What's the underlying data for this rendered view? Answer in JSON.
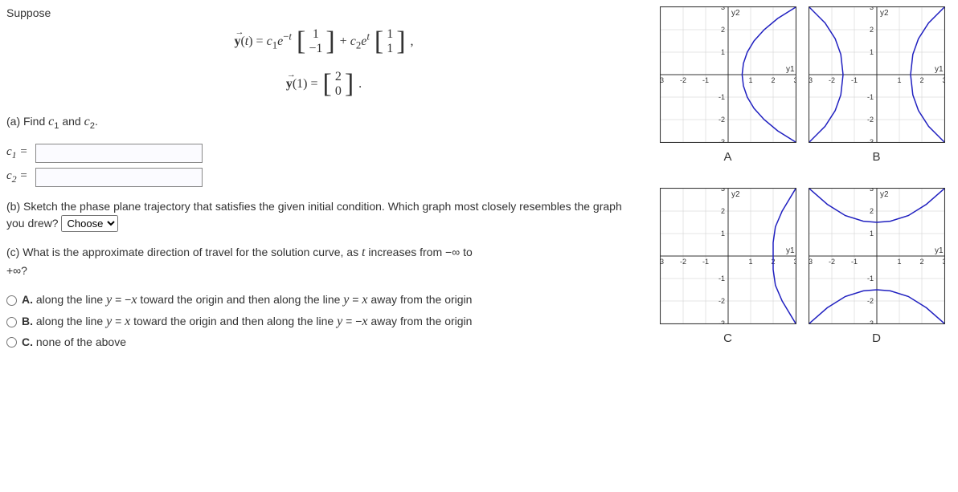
{
  "intro": "Suppose",
  "equations": {
    "y_of_t_lhs": "y",
    "t_var": "(t) = c",
    "eq1_text": "y(t) = c₁e^{-t} [1; -1] + c₂e^{t} [1; 1],",
    "eq2_text": "y(1) = [2; 0].",
    "matrix1_r1": "1",
    "matrix1_r2": "−1",
    "matrix2_r1": "1",
    "matrix2_r2": "1",
    "matrix3_r1": "2",
    "matrix3_r2": "0"
  },
  "part_a": {
    "prompt": "(a) Find c₁ and c₂.",
    "c1_label": "c₁ =",
    "c2_label": "c₂ =",
    "c1_value": "",
    "c2_value": ""
  },
  "part_b": {
    "prompt": "(b) Sketch the phase plane trajectory that satisfies the given initial condition. Which graph most closely resembles the graph you drew?",
    "select_placeholder": "Choose",
    "options": [
      "Choose",
      "A",
      "B",
      "C",
      "D"
    ]
  },
  "part_c": {
    "prompt_line1": "(c) What is the approximate direction of travel for the solution curve, as t increases from −∞ to",
    "prompt_line2": "+∞?",
    "opt_a_label": "A.",
    "opt_a_text": " along the line y = −x toward the origin and then along the line y = x away from the origin",
    "opt_b_label": "B.",
    "opt_b_text": " along the line y = x toward the origin and then along the line y = −x away from the origin",
    "opt_c_label": "C.",
    "opt_c_text": " none of the above"
  },
  "graphs": {
    "A": "A",
    "B": "B",
    "C": "C",
    "D": "D",
    "y1": "y1",
    "y2": "y2"
  },
  "chart_data": [
    {
      "id": "A",
      "type": "phase-plane",
      "xlim": [
        -3,
        3
      ],
      "ylim": [
        -3,
        3
      ],
      "xlabel": "y1",
      "ylabel": "y2",
      "ticks_x": [
        -3,
        -2,
        -1,
        1,
        2,
        3
      ],
      "ticks_y": [
        -3,
        -2,
        -1,
        1,
        2,
        3
      ],
      "description": "Curve opens to the left; passes through (2,0) vertex region on right",
      "curve": [
        [
          3,
          3
        ],
        [
          2.2,
          2.5
        ],
        [
          1.6,
          2
        ],
        [
          1.15,
          1.5
        ],
        [
          0.85,
          1
        ],
        [
          0.68,
          0.5
        ],
        [
          0.62,
          0
        ],
        [
          0.68,
          -0.5
        ],
        [
          0.85,
          -1
        ],
        [
          1.15,
          -1.5
        ],
        [
          1.6,
          -2
        ],
        [
          2.2,
          -2.5
        ],
        [
          3,
          -3
        ]
      ]
    },
    {
      "id": "B",
      "type": "phase-plane",
      "xlim": [
        -3,
        3
      ],
      "ylim": [
        -3,
        3
      ],
      "xlabel": "y1",
      "ylabel": "y2",
      "ticks_x": [
        -3,
        -2,
        -1,
        1,
        2,
        3
      ],
      "ticks_y": [
        -3,
        -2,
        -1,
        1,
        2,
        3
      ],
      "description": "Two branches hyperbola opening left & right with vertices near x=±1.5",
      "curve_left": [
        [
          -3,
          3
        ],
        [
          -2.3,
          2.3
        ],
        [
          -1.85,
          1.6
        ],
        [
          -1.6,
          0.9
        ],
        [
          -1.5,
          0
        ],
        [
          -1.6,
          -0.9
        ],
        [
          -1.85,
          -1.6
        ],
        [
          -2.3,
          -2.3
        ],
        [
          -3,
          -3
        ]
      ],
      "curve_right": [
        [
          3,
          3
        ],
        [
          2.3,
          2.3
        ],
        [
          1.85,
          1.6
        ],
        [
          1.6,
          0.9
        ],
        [
          1.5,
          0
        ],
        [
          1.6,
          -0.9
        ],
        [
          1.85,
          -1.6
        ],
        [
          2.3,
          -2.3
        ],
        [
          3,
          -3
        ]
      ]
    },
    {
      "id": "C",
      "type": "phase-plane",
      "xlim": [
        -3,
        3
      ],
      "ylim": [
        -3,
        3
      ],
      "xlabel": "y1",
      "ylabel": "y2",
      "ticks_x": [
        -3,
        -2,
        -1,
        1,
        2,
        3
      ],
      "ticks_y": [
        -3,
        -2,
        -1,
        1,
        2,
        3
      ],
      "description": "Curve opens to the right; vertex near (2,0)",
      "curve": [
        [
          3,
          3
        ],
        [
          2.4,
          2.0
        ],
        [
          2.1,
          1.3
        ],
        [
          2.0,
          0.6
        ],
        [
          2.0,
          0
        ],
        [
          2.0,
          -0.6
        ],
        [
          2.1,
          -1.3
        ],
        [
          2.4,
          -2.0
        ],
        [
          3,
          -3
        ]
      ]
    },
    {
      "id": "D",
      "type": "phase-plane",
      "xlim": [
        -3,
        3
      ],
      "ylim": [
        -3,
        3
      ],
      "xlabel": "y1",
      "ylabel": "y2",
      "ticks_x": [
        -3,
        -2,
        -1,
        1,
        2,
        3
      ],
      "ticks_y": [
        -3,
        -2,
        -1,
        1,
        2,
        3
      ],
      "description": "Two branches opening up & down with vertices near y=±1.5",
      "curve_top": [
        [
          -3,
          3
        ],
        [
          -2.2,
          2.3
        ],
        [
          -1.4,
          1.8
        ],
        [
          -0.6,
          1.55
        ],
        [
          0,
          1.5
        ],
        [
          0.6,
          1.55
        ],
        [
          1.4,
          1.8
        ],
        [
          2.2,
          2.3
        ],
        [
          3,
          3
        ]
      ],
      "curve_bottom": [
        [
          -3,
          -3
        ],
        [
          -2.2,
          -2.3
        ],
        [
          -1.4,
          -1.8
        ],
        [
          -0.6,
          -1.55
        ],
        [
          0,
          -1.5
        ],
        [
          0.6,
          -1.55
        ],
        [
          1.4,
          -1.8
        ],
        [
          2.2,
          -2.3
        ],
        [
          3,
          -3
        ]
      ]
    }
  ]
}
